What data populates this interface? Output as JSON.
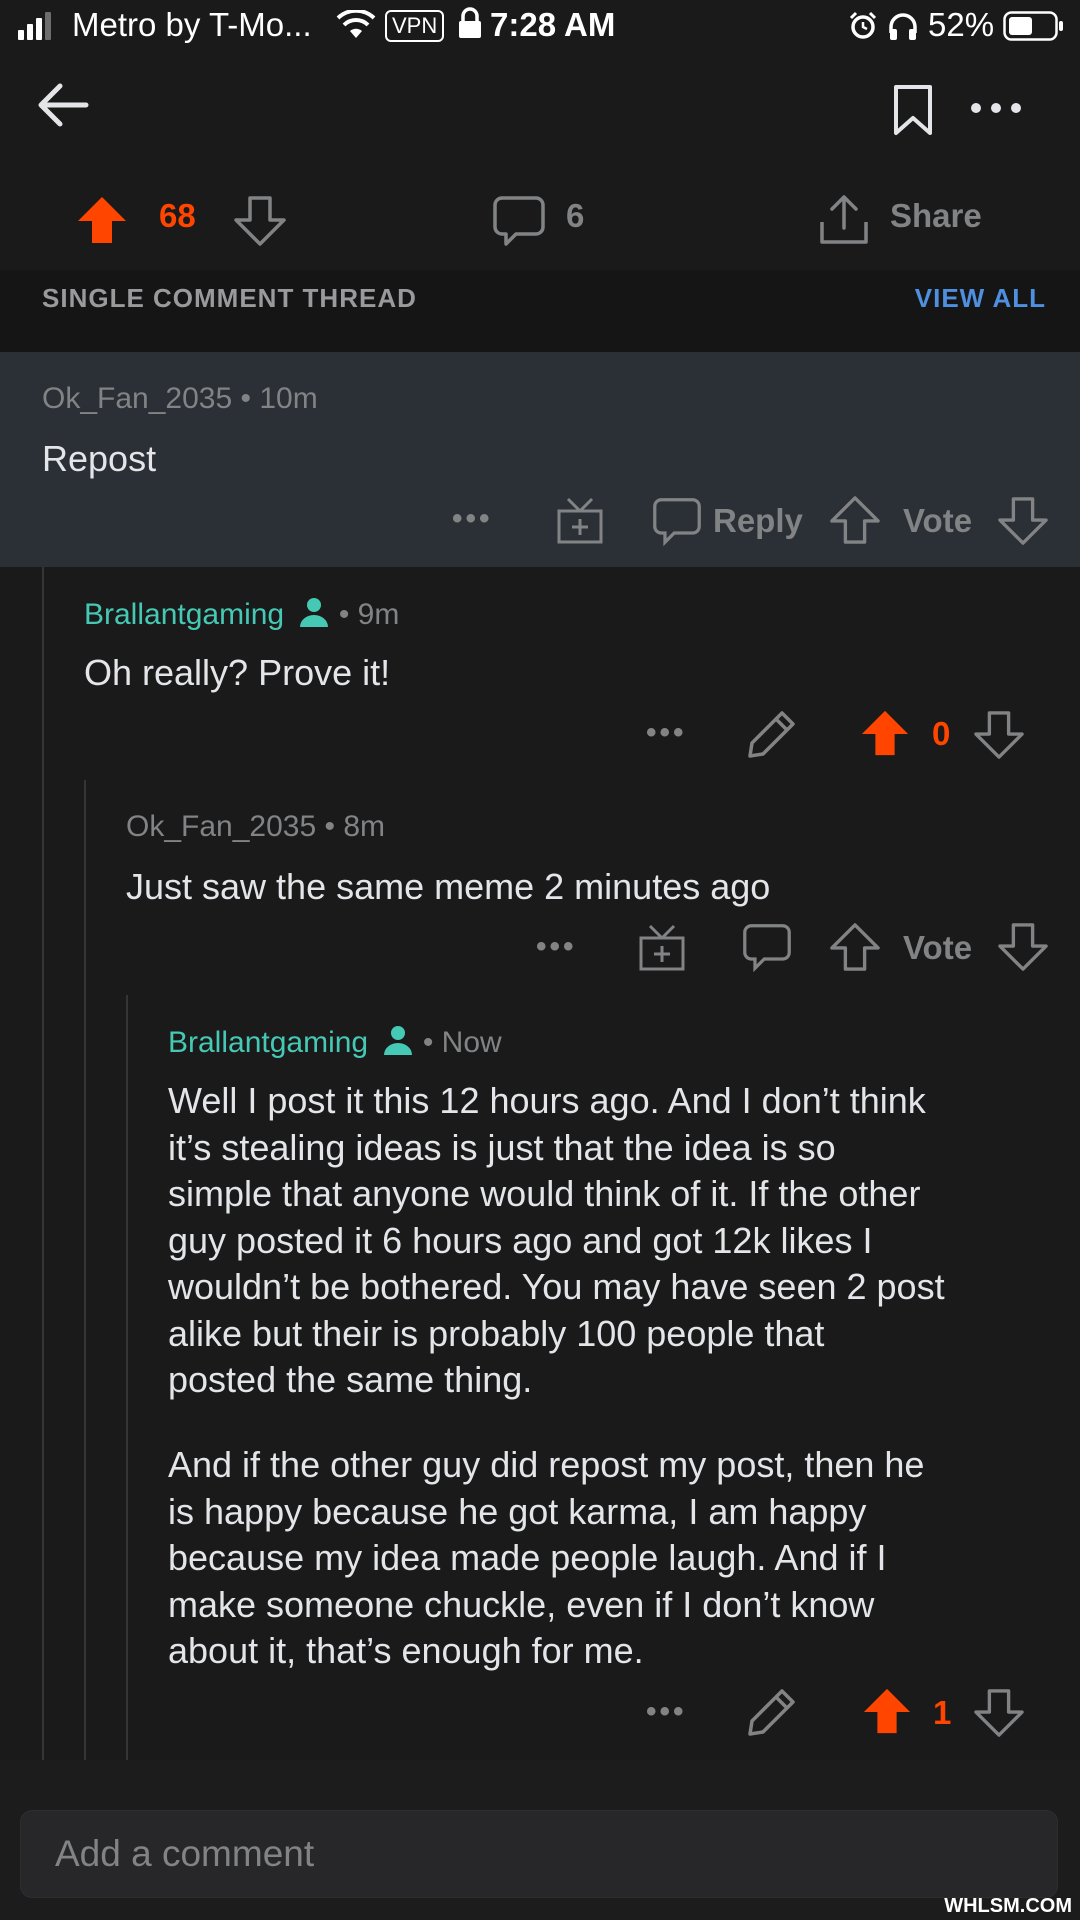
{
  "status_bar": {
    "carrier": "Metro by T-Mo...",
    "vpn": "VPN",
    "time": "7:28 AM",
    "battery": "52%"
  },
  "post": {
    "upvotes": "68",
    "comments": "6",
    "share_label": "Share"
  },
  "thread_header": {
    "label": "SINGLE COMMENT THREAD",
    "view_all": "VIEW ALL"
  },
  "comments": [
    {
      "author": "Ok_Fan_2035",
      "time": "10m",
      "text": "Repost",
      "actions": {
        "reply": "Reply",
        "vote": "Vote"
      }
    },
    {
      "author": "Brallantgaming",
      "time": "9m",
      "text": "Oh really? Prove it!",
      "score": "0"
    },
    {
      "author": "Ok_Fan_2035",
      "time": "8m",
      "text": "Just saw the same meme 2 minutes ago",
      "actions": {
        "vote": "Vote"
      }
    },
    {
      "author": "Brallantgaming",
      "time": "Now",
      "paragraphs": [
        [
          "Well I post it this 12 hours ago. And I don’t think",
          "it’s stealing ideas is just that the idea is so",
          "simple that anyone would think of it. If the other",
          "guy posted it 6 hours ago and got 12k likes I",
          "wouldn’t be bothered. You may have seen 2 post",
          "alike but their is probably 100 people that",
          "posted the same thing."
        ],
        [
          "And if the other guy did repost my post, then he",
          "is happy because he got karma, I am happy",
          "because my idea made people laugh. And if I",
          "make someone chuckle, even if I don’t know",
          "about it, that’s enough for me."
        ]
      ],
      "score": "1"
    }
  ],
  "composer": {
    "placeholder": "Add a comment"
  },
  "watermark": "WHLSM.COM",
  "colors": {
    "accent_orange": "#ff4500",
    "username_green": "#46c9b4",
    "link_blue": "#4f8fe0",
    "highlight_bg": "#2b2f36"
  }
}
